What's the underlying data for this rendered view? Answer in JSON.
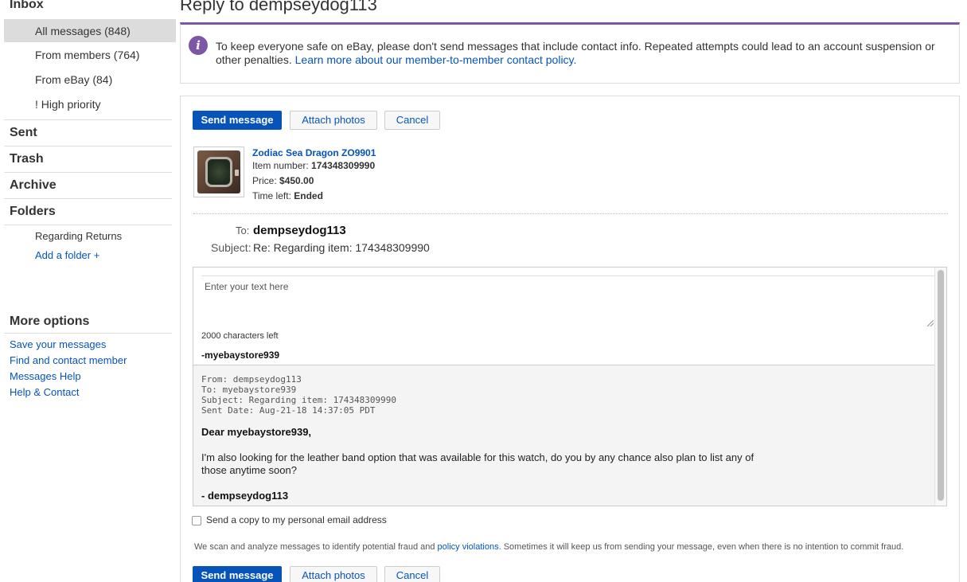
{
  "sidebar": {
    "inbox_label": "Inbox",
    "inbox_items": [
      {
        "label": "All messages (848)"
      },
      {
        "label": "From members (764)"
      },
      {
        "label": "From eBay (84)"
      },
      {
        "label": "! High priority"
      }
    ],
    "sent_label": "Sent",
    "trash_label": "Trash",
    "archive_label": "Archive",
    "folders_label": "Folders",
    "folder_items": [
      {
        "label": "Regarding Returns"
      }
    ],
    "add_folder": "Add a folder +",
    "more_options_label": "More options",
    "options": [
      {
        "label": "Save your messages"
      },
      {
        "label": "Find and contact member"
      },
      {
        "label": "Messages Help"
      },
      {
        "label": "Help & Contact"
      }
    ]
  },
  "main": {
    "title": "Reply to dempseydog113",
    "notice": {
      "text": "To keep everyone safe on eBay, please don't send messages that include contact info. Repeated attempts could lead to an account suspension or other penalties. ",
      "link": "Learn more about our member-to-member contact policy."
    },
    "buttons": {
      "send": "Send message",
      "attach": "Attach photos",
      "cancel": "Cancel"
    },
    "item": {
      "title": "Zodiac Sea Dragon ZO9901",
      "number_label": "Item number:",
      "number": "174348309990",
      "price_label": "Price:",
      "price": "$450.00",
      "time_label": "Time left:",
      "time": "Ended"
    },
    "to_label": "To:",
    "to_value": "dempseydog113",
    "subject_label": "Subject:",
    "subject_value": "Re: Regarding item: 174348309990",
    "compose": {
      "placeholder": "Enter your text here",
      "chars_left": "2000 characters left",
      "signature": "-myebaystore939"
    },
    "quoted": {
      "from": "From: dempseydog113",
      "to": "To: myebaystore939",
      "subject": "Subject: Regarding item: 174348309990",
      "sent_date": "Sent Date: Aug-21-18 14:37:05 PDT",
      "greeting": "Dear myebaystore939,",
      "body": "I'm also looking for the leather band option that was available for this watch, do you by any chance also plan to list any of those anytime soon?",
      "sign_off": "- dempseydog113"
    },
    "copy_label": "Send a copy to my personal email address",
    "disclaimer_pre": "We scan and analyze messages to identify potential fraud and ",
    "disclaimer_link": "policy violations",
    "disclaimer_post": ". Sometimes it will keep us from sending your message, even when there is no intention to commit fraud."
  },
  "colors": {
    "primary_blue": "#0654ba",
    "notice_purple": "#7d56a8"
  }
}
